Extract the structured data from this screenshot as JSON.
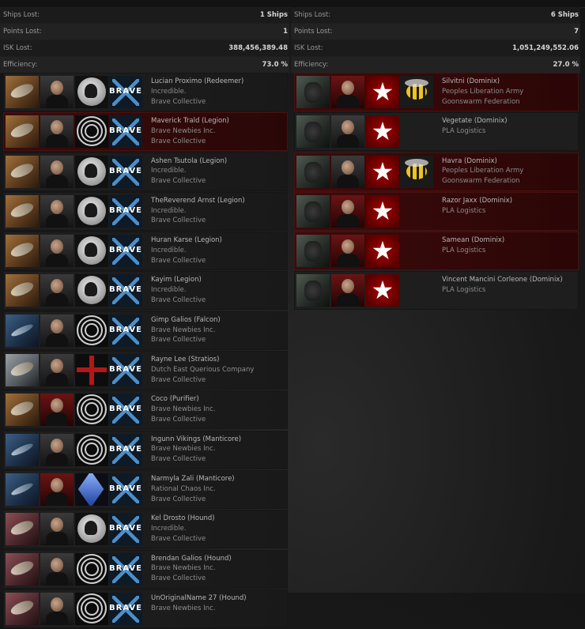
{
  "left_stats": [
    {
      "label": "Ships Lost:",
      "value": "1 Ships"
    },
    {
      "label": "Points Lost:",
      "value": "1"
    },
    {
      "label": "ISK Lost:",
      "value": "388,456,389.48"
    },
    {
      "label": "Efficiency:",
      "value": "73.0 %"
    }
  ],
  "right_stats": [
    {
      "label": "Ships Lost:",
      "value": "6 Ships"
    },
    {
      "label": "Points Lost:",
      "value": "7"
    },
    {
      "label": "ISK Lost:",
      "value": "1,051,249,552.06"
    },
    {
      "label": "Efficiency:",
      "value": "27.0 %"
    }
  ],
  "left_entries": [
    {
      "name": "Lucian Proximo (Redeemer)",
      "corp": "Incredible.",
      "alliance": "Brave Collective"
    },
    {
      "name": "Maverick Trald (Legion)",
      "corp": "Brave Newbies Inc.",
      "alliance": "Brave Collective"
    },
    {
      "name": "Ashen Tsutola (Legion)",
      "corp": "Incredible.",
      "alliance": "Brave Collective"
    },
    {
      "name": "TheReverend Arnst (Legion)",
      "corp": "Incredible.",
      "alliance": "Brave Collective"
    },
    {
      "name": "Huran Karse (Legion)",
      "corp": "Incredible.",
      "alliance": "Brave Collective"
    },
    {
      "name": "Kayim (Legion)",
      "corp": "Incredible.",
      "alliance": "Brave Collective"
    },
    {
      "name": "Gimp Galios (Falcon)",
      "corp": "Brave Newbies Inc.",
      "alliance": "Brave Collective"
    },
    {
      "name": "Rayne Lee (Stratios)",
      "corp": "Dutch East Querious Company",
      "alliance": "Brave Collective"
    },
    {
      "name": "Coco (Purifier)",
      "corp": "Brave Newbies Inc.",
      "alliance": "Brave Collective"
    },
    {
      "name": "Ingunn Vikings (Manticore)",
      "corp": "Brave Newbies Inc.",
      "alliance": "Brave Collective"
    },
    {
      "name": "Narmyla Zali (Manticore)",
      "corp": "Rational Chaos Inc.",
      "alliance": "Brave Collective"
    },
    {
      "name": "Kel Drosto (Hound)",
      "corp": "Incredible.",
      "alliance": "Brave Collective"
    },
    {
      "name": "Brendan Galios (Hound)",
      "corp": "Brave Newbies Inc.",
      "alliance": "Brave Collective"
    },
    {
      "name": "UnOriginalName 27 (Hound)",
      "corp": "Brave Newbies Inc.",
      "alliance": ""
    }
  ],
  "right_entries": [
    {
      "name": "Silvitni (Dominix)",
      "corp": "Peoples Liberation Army",
      "alliance": "Goonswarm Federation"
    },
    {
      "name": "Vegetate (Dominix)",
      "corp": "PLA Logistics",
      "alliance": ""
    },
    {
      "name": "Havra (Dominix)",
      "corp": "Peoples Liberation Army",
      "alliance": "Goonswarm Federation"
    },
    {
      "name": "Razor Jaxx (Dominix)",
      "corp": "PLA Logistics",
      "alliance": ""
    },
    {
      "name": "Samean (Dominix)",
      "corp": "PLA Logistics",
      "alliance": ""
    },
    {
      "name": "Vincent Mancini Corleone (Dominix)",
      "corp": "PLA Logistics",
      "alliance": ""
    }
  ]
}
